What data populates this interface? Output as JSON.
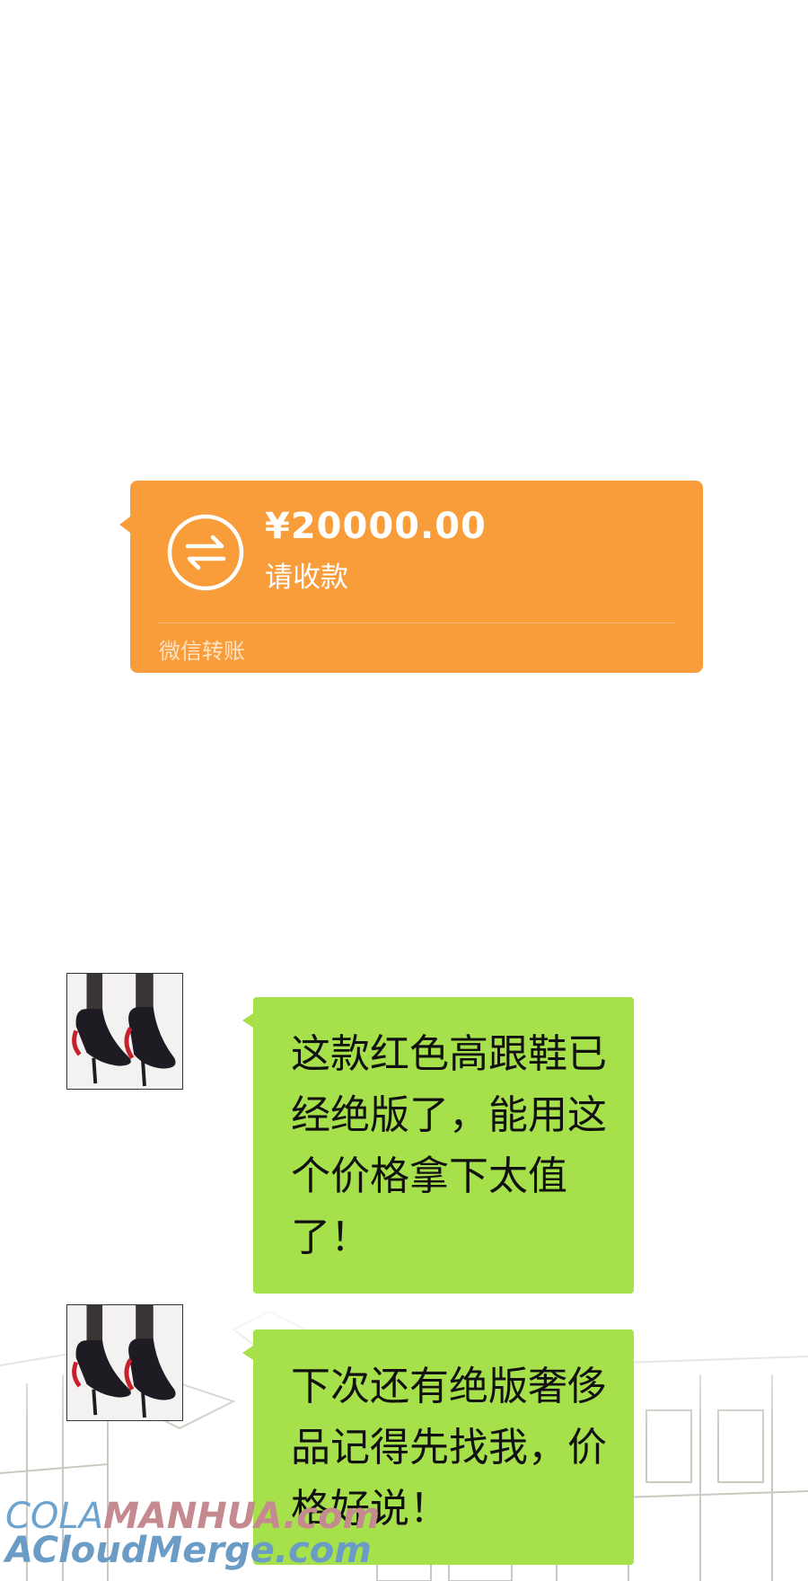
{
  "transfer": {
    "amount": "¥20000.00",
    "status": "请收款",
    "source": "微信转账",
    "icon": "transfer-arrows-icon",
    "color": "#f99d3b"
  },
  "messages": [
    {
      "text": "这款红色高跟鞋已经绝版了，能用这个价格拿下太值了！",
      "avatar": "red-heels-avatar"
    },
    {
      "text": "下次还有绝版奢侈品记得先找我，价格好说！",
      "avatar": "red-heels-avatar"
    }
  ],
  "bubble_color": "#a6e04a",
  "watermark": {
    "cola": "COLA",
    "manhua": "MANHUA.com",
    "line2": "ACloudMerge.com"
  }
}
